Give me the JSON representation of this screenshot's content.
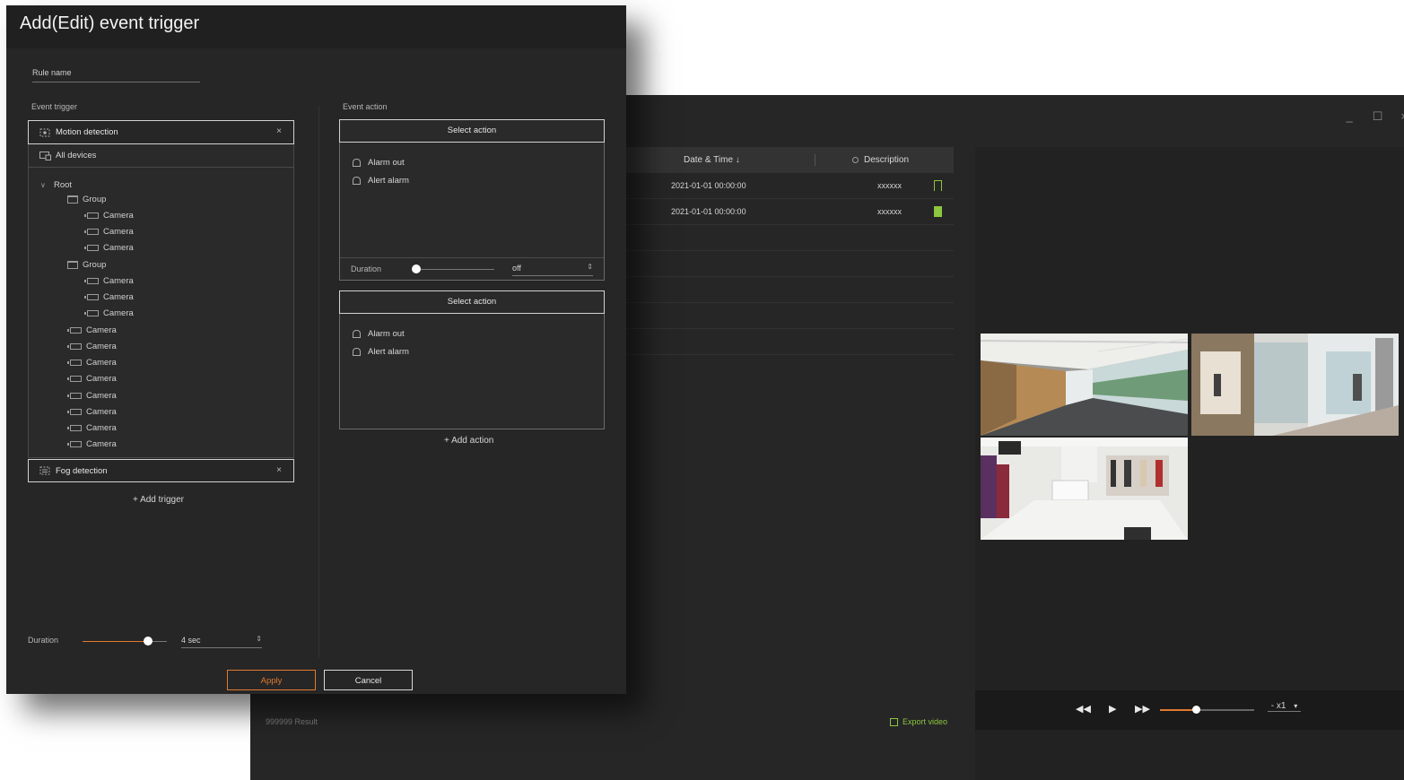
{
  "dialog": {
    "title": "Add(Edit) event trigger",
    "rule_name_placeholder": "Rule name",
    "event_trigger_label": "Event trigger",
    "event_action_label": "Event action",
    "trigger1": "Motion detection",
    "trigger2": "Fog detection",
    "close_glyph": "×",
    "all_devices": "All devices",
    "tree": {
      "root": "Root",
      "group1": "Group",
      "group2": "Group",
      "camera": "Camera"
    },
    "add_trigger": "+ Add trigger",
    "duration_label": "Duration",
    "duration_value": "4 sec",
    "duration_fraction": 0.78,
    "action1": {
      "header": "Select action",
      "items": [
        "Alarm out",
        "Alert alarm"
      ],
      "duration_label": "Duration",
      "duration_value": "off"
    },
    "action2": {
      "header": "Select action",
      "items": [
        "Alarm out",
        "Alert alarm"
      ]
    },
    "add_action": "+ Add action",
    "apply": "Apply",
    "cancel": "Cancel"
  },
  "background": {
    "window_controls": [
      "_",
      "☐",
      "×"
    ],
    "columns": {
      "date": "Date & Time ↓",
      "description": "Description"
    },
    "rows": [
      {
        "date": "2021-01-01  00:00:00",
        "description": "xxxxxx",
        "bookmarked": false
      },
      {
        "date": "2021-01-01  00:00:00",
        "description": "xxxxxx",
        "bookmarked": true
      }
    ],
    "result_count": "999999 Result",
    "export_video": "Export video",
    "playback": {
      "rewind": "◀◀",
      "play": "▶",
      "forward": "▶▶",
      "speed": "- x1",
      "speed_caret": "▾",
      "progress_fraction": 0.38
    }
  },
  "colors": {
    "accent": "#e07a2f",
    "bookmark": "#8dc63f",
    "panel": "#262626"
  }
}
